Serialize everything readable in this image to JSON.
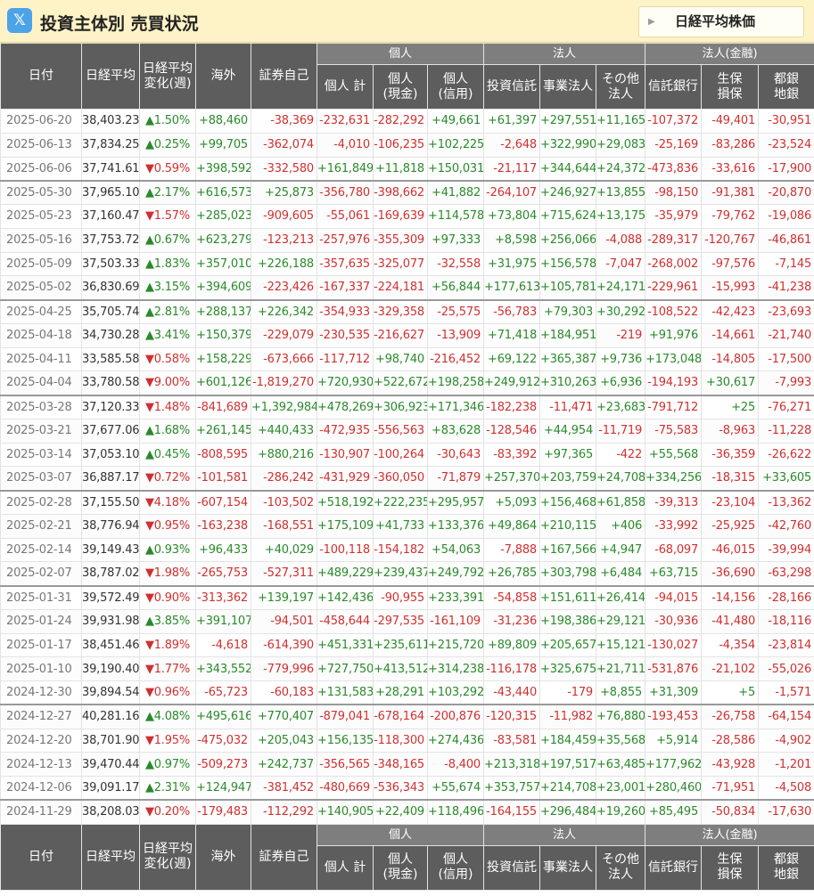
{
  "header": {
    "title": "投資主体別 売買状況",
    "nav_button": "日経平均株価"
  },
  "columns": {
    "groups": {
      "individual": "個人",
      "corporate": "法人",
      "financial": "法人(金融)"
    },
    "date": "日付",
    "nikkei": "日経平均",
    "change_l1": "日経平均",
    "change_l2": "変化(週)",
    "foreign": "海外",
    "proprietary": "証券自己",
    "ind_total": "個人 計",
    "ind_cash_l1": "個人",
    "ind_cash_l2": "(現金)",
    "ind_margin_l1": "個人",
    "ind_margin_l2": "(信用)",
    "trust": "投資信託",
    "business": "事業法人",
    "other_l1": "その他",
    "other_l2": "法人",
    "trustbank": "信託銀行",
    "insurance_l1": "生保",
    "insurance_l2": "損保",
    "regional_l1": "都銀",
    "regional_l2": "地銀"
  },
  "rows": [
    [
      "2025-06-20",
      "38,403.23",
      "▲1.50%",
      "+88,460",
      "-38,369",
      "-232,631",
      "-282,292",
      "+49,661",
      "+61,397",
      "+297,551",
      "+11,165",
      "-107,372",
      "-49,401",
      "-30,951"
    ],
    [
      "2025-06-13",
      "37,834.25",
      "▲0.25%",
      "+99,705",
      "-362,074",
      "-4,010",
      "-106,235",
      "+102,225",
      "-2,648",
      "+322,990",
      "+29,083",
      "-25,169",
      "-83,286",
      "-23,524"
    ],
    [
      "2025-06-06",
      "37,741.61",
      "▼0.59%",
      "+398,592",
      "-332,580",
      "+161,849",
      "+11,818",
      "+150,031",
      "-21,117",
      "+344,644",
      "+24,372",
      "-473,836",
      "-33,616",
      "-17,900"
    ],
    [
      "2025-05-30",
      "37,965.10",
      "▲2.17%",
      "+616,573",
      "+25,873",
      "-356,780",
      "-398,662",
      "+41,882",
      "-264,107",
      "+246,927",
      "+13,855",
      "-98,150",
      "-91,381",
      "-20,870"
    ],
    [
      "2025-05-23",
      "37,160.47",
      "▼1.57%",
      "+285,023",
      "-909,605",
      "-55,061",
      "-169,639",
      "+114,578",
      "+73,804",
      "+715,624",
      "+13,175",
      "-35,979",
      "-79,762",
      "-19,086"
    ],
    [
      "2025-05-16",
      "37,753.72",
      "▲0.67%",
      "+623,279",
      "-123,213",
      "-257,976",
      "-355,309",
      "+97,333",
      "+8,598",
      "+256,066",
      "-4,088",
      "-289,317",
      "-120,767",
      "-46,861"
    ],
    [
      "2025-05-09",
      "37,503.33",
      "▲1.83%",
      "+357,010",
      "+226,188",
      "-357,635",
      "-325,077",
      "-32,558",
      "+31,975",
      "+156,578",
      "-7,047",
      "-268,002",
      "-97,576",
      "-7,145"
    ],
    [
      "2025-05-02",
      "36,830.69",
      "▲3.15%",
      "+394,609",
      "-223,426",
      "-167,337",
      "-224,181",
      "+56,844",
      "+177,613",
      "+105,781",
      "+24,171",
      "-229,961",
      "-15,993",
      "-41,238"
    ],
    [
      "2025-04-25",
      "35,705.74",
      "▲2.81%",
      "+288,137",
      "+226,342",
      "-354,933",
      "-329,358",
      "-25,575",
      "-56,783",
      "+79,303",
      "+30,292",
      "-108,522",
      "-42,423",
      "-23,693"
    ],
    [
      "2025-04-18",
      "34,730.28",
      "▲3.41%",
      "+150,379",
      "-229,079",
      "-230,535",
      "-216,627",
      "-13,909",
      "+71,418",
      "+184,951",
      "-219",
      "+91,976",
      "-14,661",
      "-21,740"
    ],
    [
      "2025-04-11",
      "33,585.58",
      "▼0.58%",
      "+158,229",
      "-673,666",
      "-117,712",
      "+98,740",
      "-216,452",
      "+69,122",
      "+365,387",
      "+9,736",
      "+173,048",
      "-14,805",
      "-17,500"
    ],
    [
      "2025-04-04",
      "33,780.58",
      "▼9.00%",
      "+601,126",
      "-1,819,270",
      "+720,930",
      "+522,672",
      "+198,258",
      "+249,912",
      "+310,263",
      "+6,936",
      "-194,193",
      "+30,617",
      "-7,993"
    ],
    [
      "2025-03-28",
      "37,120.33",
      "▼1.48%",
      "-841,689",
      "+1,392,984",
      "+478,269",
      "+306,923",
      "+171,346",
      "-182,238",
      "-11,471",
      "+23,683",
      "-791,712",
      "+25",
      "-76,271"
    ],
    [
      "2025-03-21",
      "37,677.06",
      "▲1.68%",
      "+261,145",
      "+440,433",
      "-472,935",
      "-556,563",
      "+83,628",
      "-128,546",
      "+44,954",
      "-11,719",
      "-75,583",
      "-8,963",
      "-11,228"
    ],
    [
      "2025-03-14",
      "37,053.10",
      "▲0.45%",
      "-808,595",
      "+880,216",
      "-130,907",
      "-100,264",
      "-30,643",
      "-83,392",
      "+97,365",
      "-422",
      "+55,568",
      "-36,359",
      "-26,622"
    ],
    [
      "2025-03-07",
      "36,887.17",
      "▼0.72%",
      "-101,581",
      "-286,242",
      "-431,929",
      "-360,050",
      "-71,879",
      "+257,370",
      "+203,759",
      "+24,708",
      "+334,256",
      "-18,315",
      "+33,605"
    ],
    [
      "2025-02-28",
      "37,155.50",
      "▼4.18%",
      "-607,154",
      "-103,502",
      "+518,192",
      "+222,235",
      "+295,957",
      "+5,093",
      "+156,468",
      "+61,858",
      "-39,313",
      "-23,104",
      "-13,362"
    ],
    [
      "2025-02-21",
      "38,776.94",
      "▼0.95%",
      "-163,238",
      "-168,551",
      "+175,109",
      "+41,733",
      "+133,376",
      "+49,864",
      "+210,115",
      "+406",
      "-33,992",
      "-25,925",
      "-42,760"
    ],
    [
      "2025-02-14",
      "39,149.43",
      "▲0.93%",
      "+96,433",
      "+40,029",
      "-100,118",
      "-154,182",
      "+54,063",
      "-7,888",
      "+167,566",
      "+4,947",
      "-68,097",
      "-46,015",
      "-39,994"
    ],
    [
      "2025-02-07",
      "38,787.02",
      "▼1.98%",
      "-265,753",
      "-527,311",
      "+489,229",
      "+239,437",
      "+249,792",
      "+26,785",
      "+303,798",
      "+6,484",
      "+63,715",
      "-36,690",
      "-63,298"
    ],
    [
      "2025-01-31",
      "39,572.49",
      "▼0.90%",
      "-313,362",
      "+139,197",
      "+142,436",
      "-90,955",
      "+233,391",
      "-54,858",
      "+151,611",
      "+26,414",
      "-94,015",
      "-14,156",
      "-28,166"
    ],
    [
      "2025-01-24",
      "39,931.98",
      "▲3.85%",
      "+391,107",
      "-94,501",
      "-458,644",
      "-297,535",
      "-161,109",
      "-31,236",
      "+198,386",
      "+29,121",
      "-30,936",
      "-41,480",
      "-18,116"
    ],
    [
      "2025-01-17",
      "38,451.46",
      "▼1.89%",
      "-4,618",
      "-614,390",
      "+451,331",
      "+235,611",
      "+215,720",
      "+89,809",
      "+205,657",
      "+15,121",
      "-130,027",
      "-4,354",
      "-23,814"
    ],
    [
      "2025-01-10",
      "39,190.40",
      "▼1.77%",
      "+343,552",
      "-779,996",
      "+727,750",
      "+413,512",
      "+314,238",
      "-116,178",
      "+325,675",
      "+21,711",
      "-531,876",
      "-21,102",
      "-55,026"
    ],
    [
      "2024-12-30",
      "39,894.54",
      "▼0.96%",
      "-65,723",
      "-60,183",
      "+131,583",
      "+28,291",
      "+103,292",
      "-43,440",
      "-179",
      "+8,855",
      "+31,309",
      "+5",
      "-1,571"
    ],
    [
      "2024-12-27",
      "40,281.16",
      "▲4.08%",
      "+495,616",
      "+770,407",
      "-879,041",
      "-678,164",
      "-200,876",
      "-120,315",
      "-11,982",
      "+76,880",
      "-193,453",
      "-26,758",
      "-64,154"
    ],
    [
      "2024-12-20",
      "38,701.90",
      "▼1.95%",
      "-475,032",
      "+205,043",
      "+156,135",
      "-118,300",
      "+274,436",
      "-83,581",
      "+184,459",
      "+35,568",
      "+5,914",
      "-28,586",
      "-4,902"
    ],
    [
      "2024-12-13",
      "39,470.44",
      "▲0.97%",
      "-509,273",
      "+242,737",
      "-356,565",
      "-348,165",
      "-8,400",
      "+213,318",
      "+197,517",
      "+63,485",
      "+177,962",
      "-43,928",
      "-1,201"
    ],
    [
      "2024-12-06",
      "39,091.17",
      "▲2.31%",
      "+124,947",
      "-381,452",
      "-480,669",
      "-536,343",
      "+55,674",
      "+353,757",
      "+214,708",
      "+23,001",
      "+280,460",
      "-71,951",
      "-4,508"
    ],
    [
      "2024-11-29",
      "38,208.03",
      "▼0.20%",
      "-179,483",
      "-112,292",
      "+140,905",
      "+22,409",
      "+118,496",
      "-164,155",
      "+296,484",
      "+19,260",
      "+85,495",
      "-50,834",
      "-17,630"
    ]
  ],
  "colors": {
    "positive": "#2a8a2a",
    "negative": "#d03030",
    "header_bg": "#5d5d5d",
    "title_bar": "#fdf3c6"
  }
}
